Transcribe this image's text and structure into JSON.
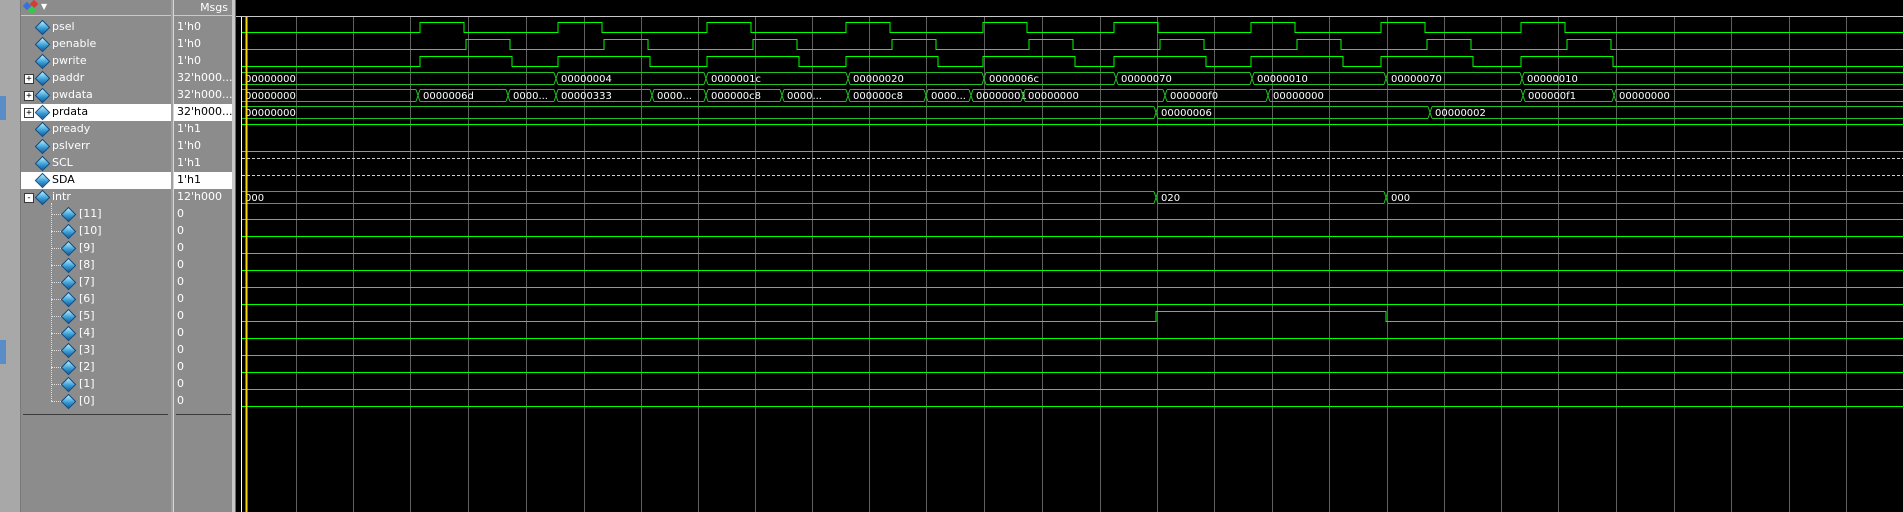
{
  "header": {
    "msgs_label": "Msgs"
  },
  "toolbar": {
    "icon": "wave-tool-icon",
    "dropdown": "chevron-down-icon"
  },
  "signals": [
    {
      "name": "psel",
      "value": "1'h0",
      "indent": 0,
      "expander": null,
      "selected": false
    },
    {
      "name": "penable",
      "value": "1'h0",
      "indent": 0,
      "expander": null,
      "selected": false
    },
    {
      "name": "pwrite",
      "value": "1'h0",
      "indent": 0,
      "expander": null,
      "selected": false
    },
    {
      "name": "paddr",
      "value": "32'h000...",
      "indent": 0,
      "expander": "+",
      "selected": false
    },
    {
      "name": "pwdata",
      "value": "32'h000...",
      "indent": 0,
      "expander": "+",
      "selected": false
    },
    {
      "name": "prdata",
      "value": "32'h000...",
      "indent": 0,
      "expander": "+",
      "selected": true
    },
    {
      "name": "pready",
      "value": "1'h1",
      "indent": 0,
      "expander": null,
      "selected": false
    },
    {
      "name": "pslverr",
      "value": "1'h0",
      "indent": 0,
      "expander": null,
      "selected": false
    },
    {
      "name": "SCL",
      "value": "1'h1",
      "indent": 0,
      "expander": null,
      "selected": false
    },
    {
      "name": "SDA",
      "value": "1'h1",
      "indent": 0,
      "expander": null,
      "selected": true
    },
    {
      "name": "intr",
      "value": "12'h000",
      "indent": 0,
      "expander": "-",
      "selected": false
    },
    {
      "name": "[11]",
      "value": "0",
      "indent": 1,
      "expander": null,
      "selected": false
    },
    {
      "name": "[10]",
      "value": "0",
      "indent": 1,
      "expander": null,
      "selected": false
    },
    {
      "name": "[9]",
      "value": "0",
      "indent": 1,
      "expander": null,
      "selected": false
    },
    {
      "name": "[8]",
      "value": "0",
      "indent": 1,
      "expander": null,
      "selected": false
    },
    {
      "name": "[7]",
      "value": "0",
      "indent": 1,
      "expander": null,
      "selected": false
    },
    {
      "name": "[6]",
      "value": "0",
      "indent": 1,
      "expander": null,
      "selected": false
    },
    {
      "name": "[5]",
      "value": "0",
      "indent": 1,
      "expander": null,
      "selected": false
    },
    {
      "name": "[4]",
      "value": "0",
      "indent": 1,
      "expander": null,
      "selected": false
    },
    {
      "name": "[3]",
      "value": "0",
      "indent": 1,
      "expander": null,
      "selected": false
    },
    {
      "name": "[2]",
      "value": "0",
      "indent": 1,
      "expander": null,
      "selected": false
    },
    {
      "name": "[1]",
      "value": "0",
      "indent": 1,
      "expander": null,
      "selected": false
    },
    {
      "name": "[0]",
      "value": "0",
      "indent": 1,
      "expander": null,
      "selected": false
    }
  ],
  "waves": {
    "bus_segments": {
      "paddr": [
        "00000000",
        "00000004",
        "0000001c",
        "00000020",
        "0000006c",
        "00000070",
        "00000010",
        "00000070",
        "00000010"
      ],
      "pwdata": [
        "00000000",
        "0000006d",
        "0000...",
        "00000333",
        "0000...",
        "000000c8",
        "0000...",
        "000000c8",
        "0000...",
        "00000001",
        "00000000",
        "000000f0",
        "00000000",
        "000000f1",
        "00000000"
      ],
      "prdata": [
        "00000000",
        "00000006",
        "00000002"
      ],
      "intr": [
        "000",
        "020",
        "000"
      ]
    },
    "colors": {
      "signal": "#00ff00",
      "bus": "#22c022",
      "grid": "#606060",
      "cursor": "#ffd800",
      "text": "#ffffff"
    }
  }
}
